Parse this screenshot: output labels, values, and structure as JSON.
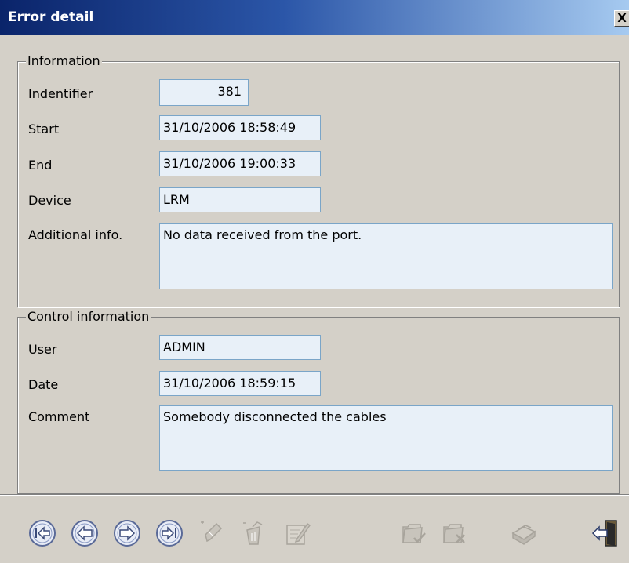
{
  "window": {
    "title": "Error detail",
    "close_glyph": "X"
  },
  "information": {
    "legend": "Information",
    "identifier_label": "Indentifier",
    "identifier_value": "381",
    "start_label": "Start",
    "start_value": "31/10/2006 18:58:49",
    "end_label": "End",
    "end_value": "31/10/2006 19:00:33",
    "device_label": "Device",
    "device_value": "LRM",
    "additional_label": "Additional info.",
    "additional_value": "No data received from the port."
  },
  "control": {
    "legend": "Control information",
    "user_label": "User",
    "user_value": "ADMIN",
    "date_label": "Date",
    "date_value": "31/10/2006 18:59:15",
    "comment_label": "Comment",
    "comment_value": "Somebody disconnected the cables"
  },
  "toolbar": {
    "buttons": [
      {
        "icon": "first-record-icon",
        "enabled": true
      },
      {
        "icon": "previous-record-icon",
        "enabled": true
      },
      {
        "icon": "next-record-icon",
        "enabled": true
      },
      {
        "icon": "last-record-icon",
        "enabled": true
      },
      {
        "icon": "add-record-icon",
        "enabled": false
      },
      {
        "icon": "delete-record-icon",
        "enabled": false
      },
      {
        "icon": "edit-record-icon",
        "enabled": false
      },
      {
        "icon": "confirm-icon",
        "enabled": false
      },
      {
        "icon": "cancel-icon",
        "enabled": false
      },
      {
        "icon": "print-icon",
        "enabled": false
      },
      {
        "icon": "exit-icon",
        "enabled": true
      }
    ]
  }
}
